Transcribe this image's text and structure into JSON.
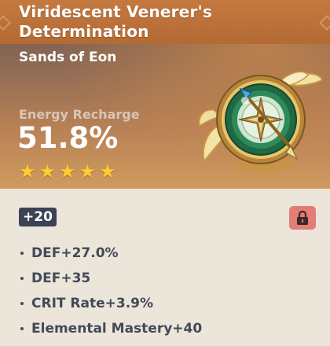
{
  "artifact": {
    "name": "Viridescent Venerer's Determination",
    "slot": "Sands of Eon",
    "main_stat": {
      "name": "Energy Recharge",
      "value": "51.8%"
    },
    "rarity": 5,
    "level": "+20",
    "locked": true,
    "icon": "viridescent-sands-icon",
    "substats": [
      "DEF+27.0%",
      "DEF+35",
      "CRIT Rate+3.9%",
      "Elemental Mastery+40"
    ]
  },
  "colors": {
    "title_bar": "#b9703a",
    "star": "#ffcc33",
    "level_badge": "#3b4354",
    "lock": "#e37d76",
    "substat_text": "#424a57"
  }
}
